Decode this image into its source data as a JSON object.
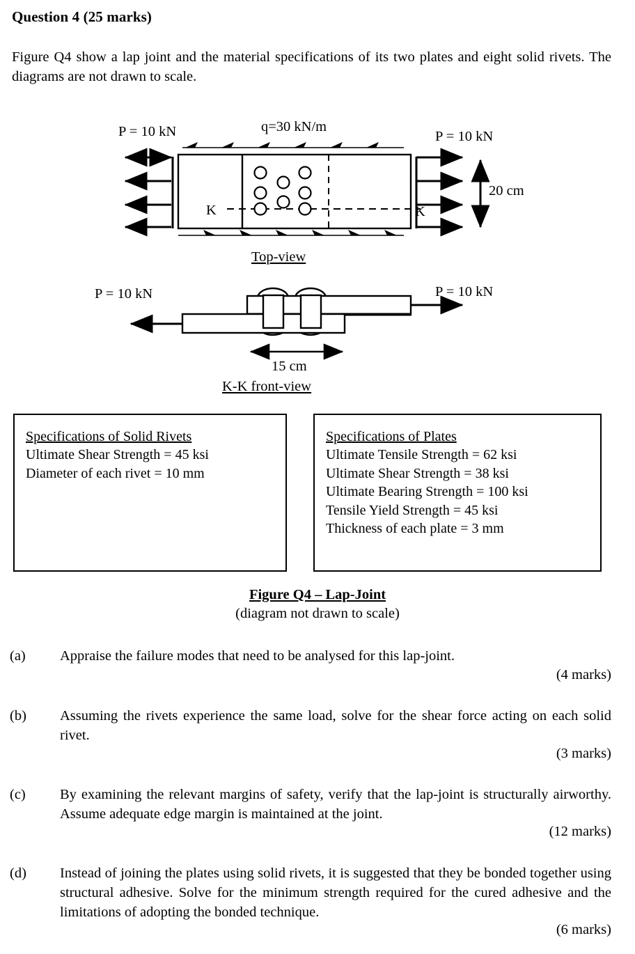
{
  "question": {
    "title": "Question 4 (25 marks)",
    "intro": "Figure Q4 show a lap joint and the material specifications of its two plates and eight solid rivets. The diagrams are not drawn to scale."
  },
  "figure": {
    "topview": {
      "label": "Top-view",
      "load_left": "P = 10 kN",
      "load_right": "P = 10 kN",
      "distributed_load": "q=30 kN/m",
      "height_dim": "20 cm",
      "section_label_left": "K",
      "section_label_right": "K",
      "rivet_count": 8
    },
    "frontview": {
      "label": "K-K front-view",
      "load_left": "P = 10 kN",
      "load_right": "P = 10 kN",
      "width_dim": "15 cm",
      "rivet_count": 2
    },
    "caption": "Figure Q4 – Lap-Joint",
    "subcaption": "(diagram not drawn to scale)"
  },
  "specs": {
    "rivets": {
      "heading": "Specifications of Solid Rivets",
      "lines": [
        "Ultimate Shear Strength = 45 ksi",
        "Diameter of each rivet = 10 mm"
      ]
    },
    "plates": {
      "heading": "Specifications of Plates",
      "lines": [
        "Ultimate Tensile Strength = 62 ksi",
        "Ultimate Shear Strength = 38 ksi",
        "Ultimate Bearing Strength = 100 ksi",
        "Tensile Yield Strength = 45 ksi",
        "Thickness of each plate = 3 mm"
      ]
    }
  },
  "parts": [
    {
      "label": "(a)",
      "text": "Appraise the failure modes that need to be analysed for this lap-joint.",
      "marks": "(4 marks)"
    },
    {
      "label": "(b)",
      "text": "Assuming the rivets experience the same load, solve for the shear force acting on each solid rivet.",
      "marks": "(3 marks)"
    },
    {
      "label": "(c)",
      "text": "By examining the relevant margins of safety, verify that the lap-joint is structurally airworthy. Assume adequate edge margin is maintained at the joint.",
      "marks": "(12 marks)"
    },
    {
      "label": "(d)",
      "text": "Instead of joining the plates using solid rivets, it is suggested that they be bonded together using structural adhesive. Solve for the minimum strength required for the cured adhesive and the limitations of adopting the bonded technique.",
      "marks": "(6 marks)"
    }
  ]
}
